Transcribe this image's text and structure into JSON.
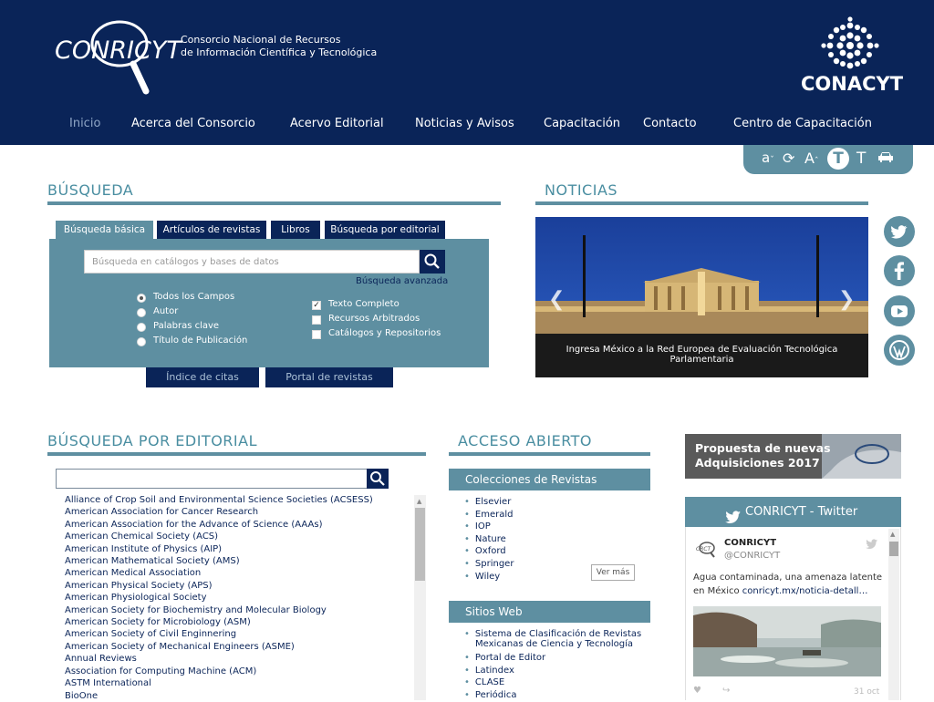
{
  "header": {
    "brand_name": "CONRICYT",
    "brand_subtitle_line1": "Consorcio Nacional de Recursos",
    "brand_subtitle_line2": "de Información Científica y Tecnológica",
    "partner_name": "CONACYT"
  },
  "nav": {
    "items": [
      "Inicio",
      "Acerca del Consorcio",
      "Acervo Editorial",
      "Noticias y Avisos",
      "Capacitación",
      "Contacto",
      "Centro de Capacitación"
    ],
    "active": "Inicio"
  },
  "a11y_tools": {
    "decrease": "a",
    "increase": "A",
    "text_big": "T",
    "text_small": "T"
  },
  "busqueda": {
    "title": "BÚSQUEDA",
    "tabs": [
      "Búsqueda básica",
      "Artículos de revistas",
      "Libros",
      "Búsqueda por editorial"
    ],
    "search_placeholder": "Búsqueda en catálogos y bases de datos",
    "advanced_link": "Búsqueda avanzada",
    "radio_options": [
      "Todos los Campos",
      "Autor",
      "Palabras clave",
      "Título de Publicación"
    ],
    "check_options": [
      "Texto Completo",
      "Recursos Arbitrados",
      "Catálogos y Repositorios"
    ],
    "buttons": [
      "Índice de citas",
      "Portal de revistas"
    ]
  },
  "noticias": {
    "title": "NOTICIAS",
    "caption": "Ingresa México a la Red Europea de Evaluación Tecnológica Parlamentaria"
  },
  "editorial": {
    "title": "BÚSQUEDA POR EDITORIAL",
    "items": [
      "Alliance of Crop Soil and Environmental Science Societies (ACSESS)",
      "American Association for Cancer Research",
      "American Association for the Advance of Science (AAAs)",
      "American Chemical Society (ACS)",
      "American Institute of Physics (AIP)",
      "American Mathematical Society (AMS)",
      "American Medical Association",
      "American Physical Society (APS)",
      "American Physiological Society",
      "American Society for Biochemistry and Molecular Biology",
      "American Society for Microbiology (ASM)",
      "American Society of Civil Enginnering",
      "American Society of Mechanical Engineers (ASME)",
      "Annual Reviews",
      "Association for Computing Machine (ACM)",
      "ASTM International",
      "BioOne"
    ]
  },
  "acceso_abierto": {
    "title": "ACCESO ABIERTO",
    "colecciones_title": "Colecciones de Revistas",
    "colecciones": [
      "Elsevier",
      "Emerald",
      "IOP",
      "Nature",
      "Oxford",
      "Springer",
      "Wiley"
    ],
    "ver_mas": "Ver más",
    "sitios_title": "Sitios Web",
    "sitios": [
      "Sistema de Clasificación de Revistas Mexicanas de Ciencia y Tecnología",
      "Portal de Editor",
      "Latindex",
      "CLASE",
      "Periódica"
    ]
  },
  "promo": {
    "line1": "Propuesta de nuevas",
    "line2": "Adquisiciones 2017"
  },
  "twitter": {
    "header": "CONRICYT - Twitter",
    "account_name": "CONRICYT",
    "handle": "@CONRICYT",
    "tweet_text": "Agua contaminada, una amenaza latente en México",
    "tweet_link": "conricyt.mx/noticia-detall…",
    "date": "31 oct"
  }
}
